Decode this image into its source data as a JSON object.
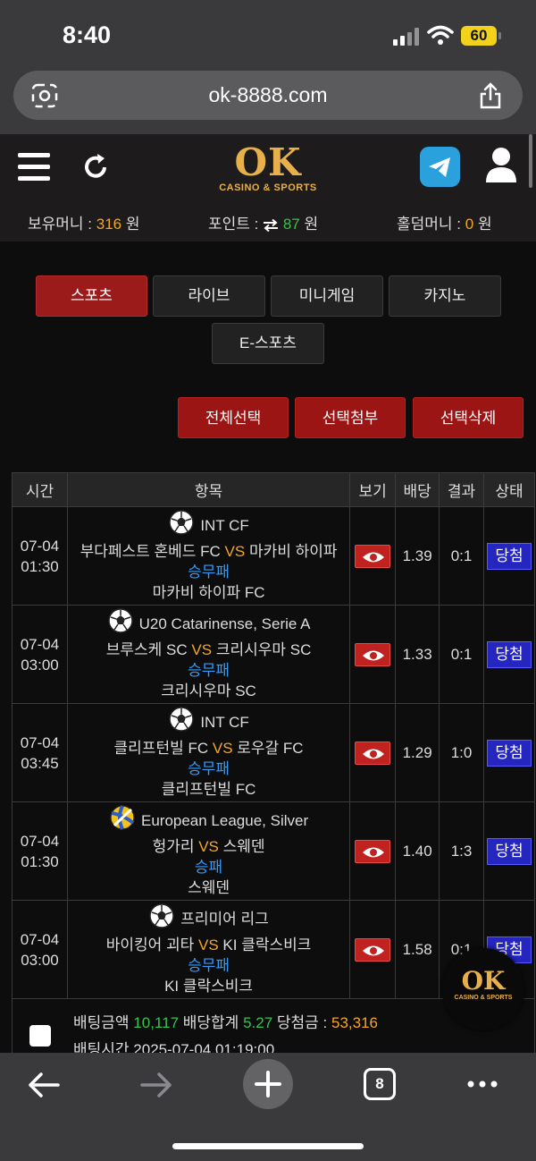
{
  "status_bar": {
    "time": "8:40",
    "battery": "60"
  },
  "browser": {
    "url": "ok-8888.com",
    "open_tabs": "8"
  },
  "header": {
    "logo_text": "OK",
    "logo_sub": "CASINO & SPORTS",
    "holding_money_label": "보유머니 :",
    "holding_money_value": "316",
    "points_label": "포인트 :",
    "points_value": "87",
    "holdem_label": "홀덤머니 :",
    "holdem_value": "0",
    "currency": "원"
  },
  "categories": [
    "스포츠",
    "라이브",
    "미니게임",
    "카지노",
    "E-스포츠"
  ],
  "actions": {
    "select_all": "전체선택",
    "select_attach": "선택첨부",
    "select_delete": "선택삭제"
  },
  "table": {
    "headers": [
      "시간",
      "항목",
      "보기",
      "배당",
      "결과",
      "상태"
    ],
    "rows": [
      {
        "date": "07-04",
        "time": "01:30",
        "league": "INT CF",
        "sport": "soccer",
        "home": "부다페스트 혼베드 FC",
        "vs": "VS",
        "away": "마카비 하이파",
        "market": "승무패",
        "pick": "마카비 하이파 FC",
        "odds": "1.39",
        "result": "0:1",
        "status": "당첨"
      },
      {
        "date": "07-04",
        "time": "03:00",
        "league": "U20 Catarinense, Serie A",
        "sport": "soccer",
        "home": "브루스케 SC",
        "vs": "VS",
        "away": "크리시우마 SC",
        "market": "승무패",
        "pick": "크리시우마 SC",
        "odds": "1.33",
        "result": "0:1",
        "status": "당첨"
      },
      {
        "date": "07-04",
        "time": "03:45",
        "league": "INT CF",
        "sport": "soccer",
        "home": "클리프턴빌 FC",
        "vs": "VS",
        "away": "로우갈 FC",
        "market": "승무패",
        "pick": "클리프턴빌 FC",
        "odds": "1.29",
        "result": "1:0",
        "status": "당첨"
      },
      {
        "date": "07-04",
        "time": "01:30",
        "league": "European League, Silver",
        "sport": "volleyball",
        "home": "헝가리",
        "vs": "VS",
        "away": "스웨덴",
        "market": "승패",
        "pick": "스웨덴",
        "odds": "1.40",
        "result": "1:3",
        "status": "당첨"
      },
      {
        "date": "07-04",
        "time": "03:00",
        "league": "프리미어 리그",
        "sport": "soccer",
        "home": "바이킹어 괴타",
        "vs": "VS",
        "away": "KI 클락스비크",
        "market": "승무패",
        "pick": "KI 클락스비크",
        "odds": "1.58",
        "result": "0:1",
        "status": "당첨"
      }
    ]
  },
  "summary": {
    "bet_amount_label": "배팅금액",
    "bet_amount": "10,117",
    "odds_total_label": "배당합계",
    "odds_total": "5.27",
    "win_amount_label": "당첨금 :",
    "win_amount": "53,316",
    "bet_time_label": "배팅시간",
    "bet_time": "2025-07-04 01:19:00"
  },
  "colors": {
    "accent_red": "#9b1b1b",
    "odds_green": "#36c24b",
    "gold": "#e8b04a",
    "market_blue": "#2f9bff",
    "win_blue": "#2525c0"
  }
}
